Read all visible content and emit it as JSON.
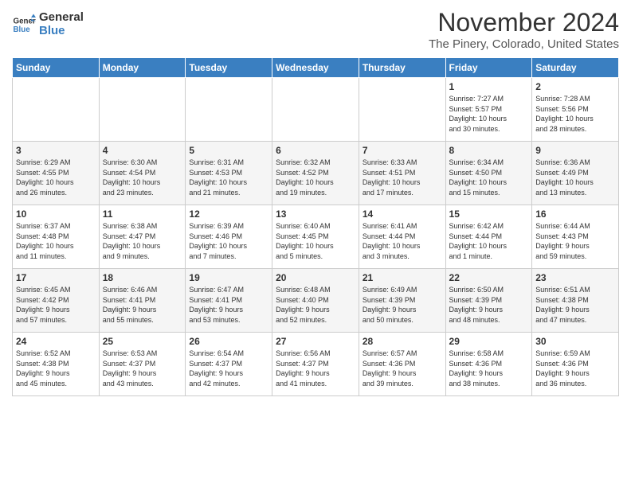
{
  "header": {
    "logo_line1": "General",
    "logo_line2": "Blue",
    "month": "November 2024",
    "location": "The Pinery, Colorado, United States"
  },
  "weekdays": [
    "Sunday",
    "Monday",
    "Tuesday",
    "Wednesday",
    "Thursday",
    "Friday",
    "Saturday"
  ],
  "weeks": [
    [
      {
        "day": "",
        "info": ""
      },
      {
        "day": "",
        "info": ""
      },
      {
        "day": "",
        "info": ""
      },
      {
        "day": "",
        "info": ""
      },
      {
        "day": "",
        "info": ""
      },
      {
        "day": "1",
        "info": "Sunrise: 7:27 AM\nSunset: 5:57 PM\nDaylight: 10 hours\nand 30 minutes."
      },
      {
        "day": "2",
        "info": "Sunrise: 7:28 AM\nSunset: 5:56 PM\nDaylight: 10 hours\nand 28 minutes."
      }
    ],
    [
      {
        "day": "3",
        "info": "Sunrise: 6:29 AM\nSunset: 4:55 PM\nDaylight: 10 hours\nand 26 minutes."
      },
      {
        "day": "4",
        "info": "Sunrise: 6:30 AM\nSunset: 4:54 PM\nDaylight: 10 hours\nand 23 minutes."
      },
      {
        "day": "5",
        "info": "Sunrise: 6:31 AM\nSunset: 4:53 PM\nDaylight: 10 hours\nand 21 minutes."
      },
      {
        "day": "6",
        "info": "Sunrise: 6:32 AM\nSunset: 4:52 PM\nDaylight: 10 hours\nand 19 minutes."
      },
      {
        "day": "7",
        "info": "Sunrise: 6:33 AM\nSunset: 4:51 PM\nDaylight: 10 hours\nand 17 minutes."
      },
      {
        "day": "8",
        "info": "Sunrise: 6:34 AM\nSunset: 4:50 PM\nDaylight: 10 hours\nand 15 minutes."
      },
      {
        "day": "9",
        "info": "Sunrise: 6:36 AM\nSunset: 4:49 PM\nDaylight: 10 hours\nand 13 minutes."
      }
    ],
    [
      {
        "day": "10",
        "info": "Sunrise: 6:37 AM\nSunset: 4:48 PM\nDaylight: 10 hours\nand 11 minutes."
      },
      {
        "day": "11",
        "info": "Sunrise: 6:38 AM\nSunset: 4:47 PM\nDaylight: 10 hours\nand 9 minutes."
      },
      {
        "day": "12",
        "info": "Sunrise: 6:39 AM\nSunset: 4:46 PM\nDaylight: 10 hours\nand 7 minutes."
      },
      {
        "day": "13",
        "info": "Sunrise: 6:40 AM\nSunset: 4:45 PM\nDaylight: 10 hours\nand 5 minutes."
      },
      {
        "day": "14",
        "info": "Sunrise: 6:41 AM\nSunset: 4:44 PM\nDaylight: 10 hours\nand 3 minutes."
      },
      {
        "day": "15",
        "info": "Sunrise: 6:42 AM\nSunset: 4:44 PM\nDaylight: 10 hours\nand 1 minute."
      },
      {
        "day": "16",
        "info": "Sunrise: 6:44 AM\nSunset: 4:43 PM\nDaylight: 9 hours\nand 59 minutes."
      }
    ],
    [
      {
        "day": "17",
        "info": "Sunrise: 6:45 AM\nSunset: 4:42 PM\nDaylight: 9 hours\nand 57 minutes."
      },
      {
        "day": "18",
        "info": "Sunrise: 6:46 AM\nSunset: 4:41 PM\nDaylight: 9 hours\nand 55 minutes."
      },
      {
        "day": "19",
        "info": "Sunrise: 6:47 AM\nSunset: 4:41 PM\nDaylight: 9 hours\nand 53 minutes."
      },
      {
        "day": "20",
        "info": "Sunrise: 6:48 AM\nSunset: 4:40 PM\nDaylight: 9 hours\nand 52 minutes."
      },
      {
        "day": "21",
        "info": "Sunrise: 6:49 AM\nSunset: 4:39 PM\nDaylight: 9 hours\nand 50 minutes."
      },
      {
        "day": "22",
        "info": "Sunrise: 6:50 AM\nSunset: 4:39 PM\nDaylight: 9 hours\nand 48 minutes."
      },
      {
        "day": "23",
        "info": "Sunrise: 6:51 AM\nSunset: 4:38 PM\nDaylight: 9 hours\nand 47 minutes."
      }
    ],
    [
      {
        "day": "24",
        "info": "Sunrise: 6:52 AM\nSunset: 4:38 PM\nDaylight: 9 hours\nand 45 minutes."
      },
      {
        "day": "25",
        "info": "Sunrise: 6:53 AM\nSunset: 4:37 PM\nDaylight: 9 hours\nand 43 minutes."
      },
      {
        "day": "26",
        "info": "Sunrise: 6:54 AM\nSunset: 4:37 PM\nDaylight: 9 hours\nand 42 minutes."
      },
      {
        "day": "27",
        "info": "Sunrise: 6:56 AM\nSunset: 4:37 PM\nDaylight: 9 hours\nand 41 minutes."
      },
      {
        "day": "28",
        "info": "Sunrise: 6:57 AM\nSunset: 4:36 PM\nDaylight: 9 hours\nand 39 minutes."
      },
      {
        "day": "29",
        "info": "Sunrise: 6:58 AM\nSunset: 4:36 PM\nDaylight: 9 hours\nand 38 minutes."
      },
      {
        "day": "30",
        "info": "Sunrise: 6:59 AM\nSunset: 4:36 PM\nDaylight: 9 hours\nand 36 minutes."
      }
    ]
  ]
}
